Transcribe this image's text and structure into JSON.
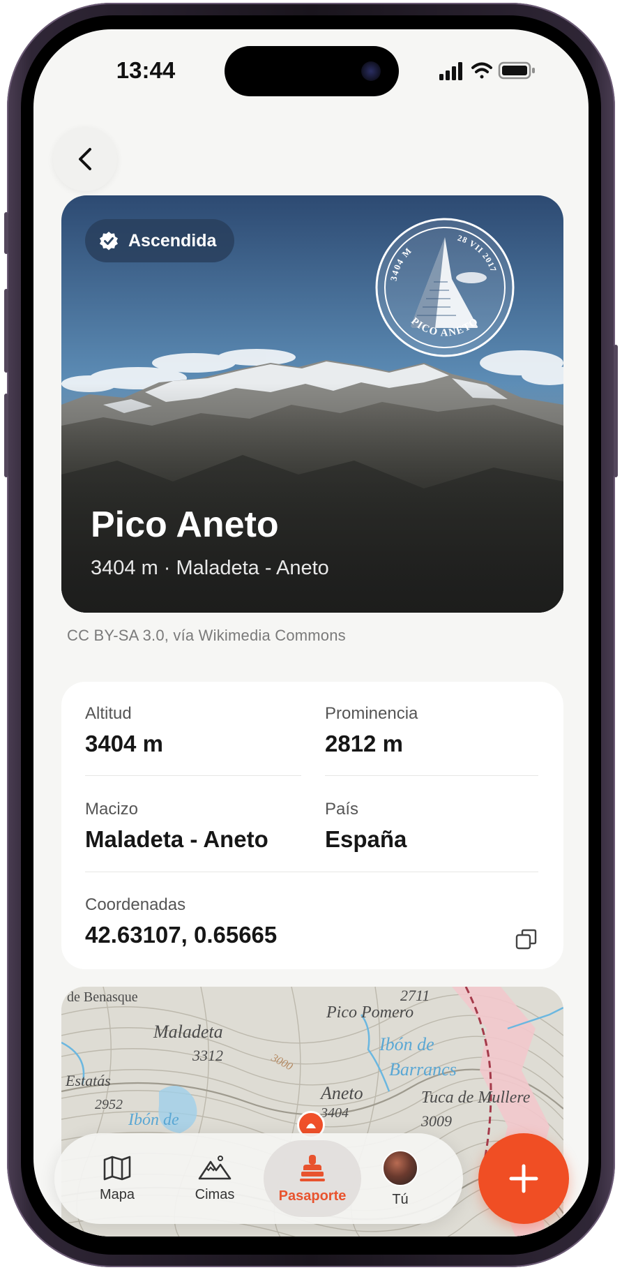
{
  "status_bar": {
    "time": "13:44"
  },
  "hero": {
    "badge_label": "Ascendida",
    "title": "Pico Aneto",
    "subtitle": "3404 m · Maladeta - Aneto",
    "stamp": {
      "altitude": "3404 M",
      "date": "28 VII 2017",
      "name": "PICO ANETO"
    },
    "photo_credit": "CC BY-SA 3.0, vía Wikimedia Commons"
  },
  "info": {
    "altitude": {
      "label": "Altitud",
      "value": "3404 m"
    },
    "prominence": {
      "label": "Prominencia",
      "value": "2812 m"
    },
    "massif": {
      "label": "Macizo",
      "value": "Maladeta - Aneto"
    },
    "country": {
      "label": "País",
      "value": "España"
    },
    "coordinates": {
      "label": "Coordenadas",
      "value": "42.63107, 0.65665"
    }
  },
  "map": {
    "labels": [
      {
        "text": "de Benasque",
        "color": "dark"
      },
      {
        "text": "2711",
        "color": "dark"
      },
      {
        "text": "Pico Pomero",
        "color": "dark"
      },
      {
        "text": "Maladeta",
        "color": "dark"
      },
      {
        "text": "3312",
        "color": "dark"
      },
      {
        "text": "Ibón de",
        "color": "blue"
      },
      {
        "text": "Barrancs",
        "color": "blue"
      },
      {
        "text": "Estatás",
        "color": "dark"
      },
      {
        "text": "2952",
        "color": "dark"
      },
      {
        "text": "Aneto",
        "color": "dark"
      },
      {
        "text": "3404",
        "color": "dark"
      },
      {
        "text": "Tuca de Mullere",
        "color": "dark"
      },
      {
        "text": "3009",
        "color": "dark"
      },
      {
        "text": "Ibón de",
        "color": "blue"
      },
      {
        "text": "3000",
        "color": "brown"
      }
    ]
  },
  "tabbar": {
    "tabs": [
      {
        "label": "Mapa",
        "icon": "map-icon"
      },
      {
        "label": "Cimas",
        "icon": "peaks-icon"
      },
      {
        "label": "Pasaporte",
        "icon": "stamp-icon",
        "active": true
      },
      {
        "label": "Tú",
        "icon": "avatar"
      }
    ]
  },
  "colors": {
    "accent": "#f04e24",
    "background": "#f6f6f4",
    "card": "#ffffff"
  }
}
